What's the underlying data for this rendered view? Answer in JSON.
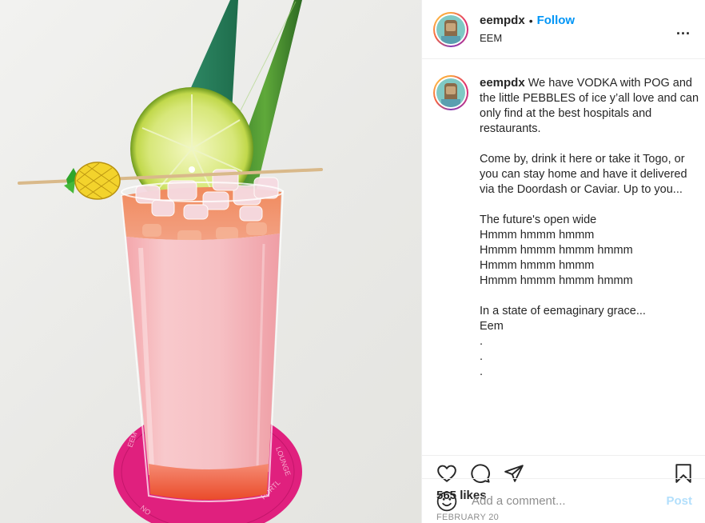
{
  "header": {
    "username": "eempdx",
    "dot": "•",
    "follow_label": "Follow",
    "location": "EEM",
    "more_label": "..."
  },
  "caption": {
    "username": "eempdx",
    "text": " We have VODKA with POG and the little PEBBLES of ice y’all love and can only find at the best hospitals and restaurants.\n\nCome by, drink it here or take it Togo, or you can stay home and have it delivered via the Doordash or Caviar. Up to you...\n\nThe future's open wide\nHmmm hmmm hmmm\nHmmm hmmm hmmm hmmm\nHmmm hmmm hmmm\nHmmm hmmm hmmm hmmm\n\nIn a state of eemaginary grace...\nEem\n.\n.\n."
  },
  "actions": {
    "like_icon": "heart-icon",
    "comment_icon": "comment-icon",
    "share_icon": "share-icon",
    "save_icon": "bookmark-icon"
  },
  "likes": "565 likes",
  "date": "FEBRUARY 20",
  "comment": {
    "placeholder": "Add a comment...",
    "post_label": "Post",
    "emoji_icon": "emoji-icon"
  },
  "colors": {
    "accent": "#0095f6",
    "post_disabled": "#b2dffc",
    "muted": "#8e8e8e",
    "coaster": "#e0207e"
  }
}
